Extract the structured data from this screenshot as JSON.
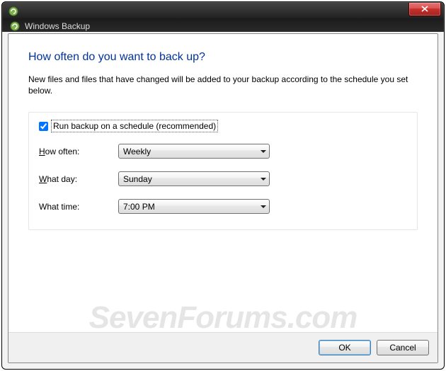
{
  "window": {
    "app_name": "Windows Backup"
  },
  "page": {
    "title": "How often do you want to back up?",
    "description": "New files and files that have changed will be added to your backup according to the schedule you set below."
  },
  "schedule": {
    "checkbox_label": "Run backup on a schedule (recommended)",
    "checkbox_checked": true,
    "rows": {
      "how_often": {
        "label_pre": "H",
        "label_post": "ow often:",
        "value": "Weekly"
      },
      "what_day": {
        "label_pre": "W",
        "label_post": "hat day:",
        "value": "Sunday"
      },
      "what_time": {
        "label_full": "What time:",
        "value": "7:00 PM"
      }
    }
  },
  "buttons": {
    "ok": "OK",
    "cancel": "Cancel"
  },
  "watermark": "SevenForums.com"
}
